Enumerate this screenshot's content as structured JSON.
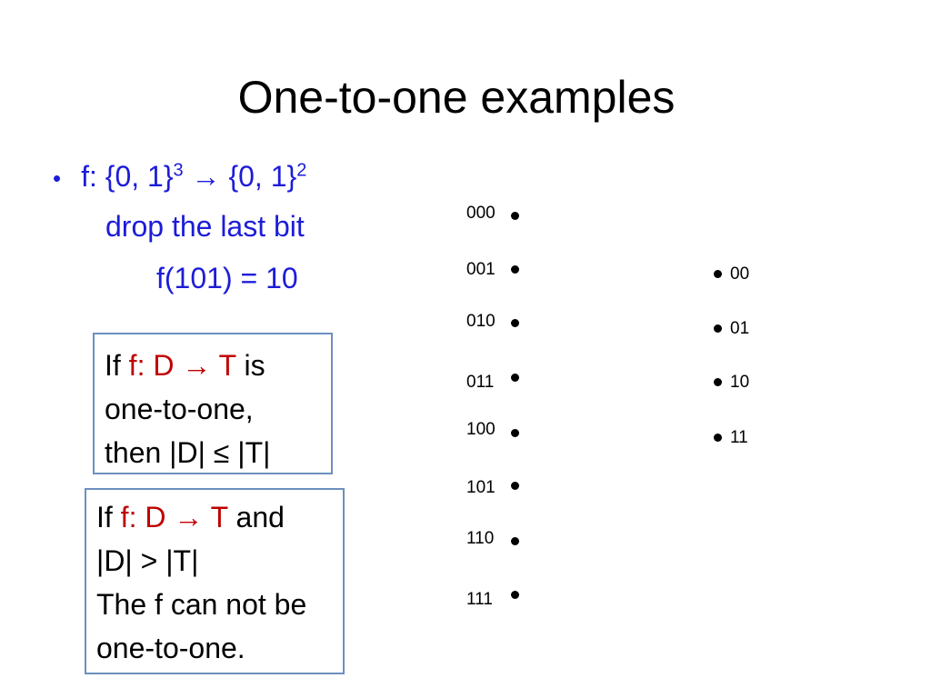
{
  "title": "One-to-one examples",
  "bullet": {
    "icon": "bullet-dot",
    "text_prefix": "f: {0, 1}",
    "exp1": "3",
    "arrow": " → {0, 1}",
    "exp2": "2",
    "line2": "drop the last bit",
    "line3": "f(101) = 10"
  },
  "box1": {
    "if": "If ",
    "fn": "f: D → T",
    "rest": " is",
    "line2": "one-to-one,",
    "line3": "then |D| ≤ |T|"
  },
  "box2": {
    "if": "If ",
    "fn": "f: D → T",
    "rest": " and",
    "line2": "|D| > |T|",
    "line3": "The f can not be",
    "line4": "one-to-one."
  },
  "domain": [
    "000",
    "001",
    "010",
    "011",
    "100",
    "101",
    "110",
    "111"
  ],
  "codomain": [
    "00",
    "01",
    "10",
    "11"
  ],
  "colors": {
    "text_blue": "#1c1cd8",
    "highlight_red": "#c00000",
    "box_border": "#6d8fc0"
  }
}
